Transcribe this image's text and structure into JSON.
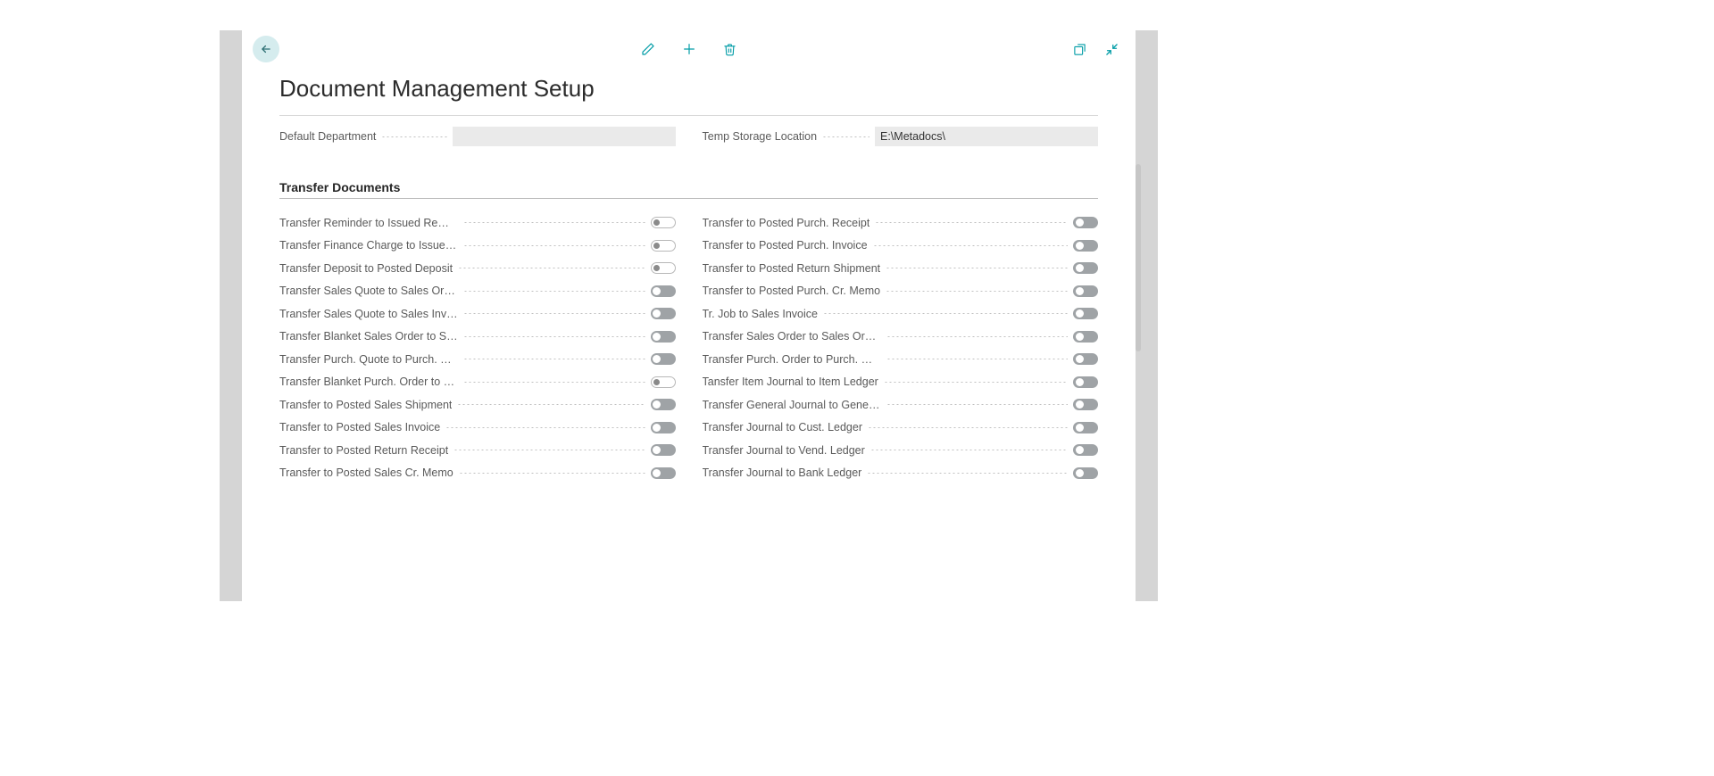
{
  "colors": {
    "accent": "#009ca6",
    "back_bg": "#d5ecee",
    "toggle_on_bg": "#9fa3a6"
  },
  "page": {
    "title": "Document Management Setup"
  },
  "header_fields": {
    "default_department": {
      "label": "Default Department",
      "value": ""
    },
    "temp_storage_location": {
      "label": "Temp Storage Location",
      "value": "E:\\Metadocs\\"
    }
  },
  "section": {
    "title": "Transfer Documents"
  },
  "toggles_left": [
    {
      "label": "Transfer Reminder to Issued Reminder",
      "on": false
    },
    {
      "label": "Transfer Finance Charge to Issued Fin...",
      "on": false
    },
    {
      "label": "Transfer Deposit to Posted Deposit",
      "on": false
    },
    {
      "label": "Transfer Sales Quote to Sales Order",
      "on": true
    },
    {
      "label": "Transfer Sales Quote to Sales Invoice",
      "on": true
    },
    {
      "label": "Transfer Blanket Sales Order to Sales ...",
      "on": true
    },
    {
      "label": "Transfer Purch. Quote to Purch. Order",
      "on": true
    },
    {
      "label": "Transfer Blanket Purch. Order to Purch...",
      "on": false
    },
    {
      "label": "Transfer to Posted Sales Shipment",
      "on": true
    },
    {
      "label": "Transfer to Posted Sales Invoice",
      "on": true
    },
    {
      "label": "Transfer to Posted Return Receipt",
      "on": true
    },
    {
      "label": "Transfer to Posted Sales Cr. Memo",
      "on": true
    }
  ],
  "toggles_right": [
    {
      "label": "Transfer to Posted Purch. Receipt",
      "on": true
    },
    {
      "label": "Transfer to Posted Purch. Invoice",
      "on": true
    },
    {
      "label": "Transfer to Posted Return Shipment",
      "on": true
    },
    {
      "label": "Transfer to Posted Purch. Cr. Memo",
      "on": true
    },
    {
      "label": "Tr. Job to Sales Invoice",
      "on": true
    },
    {
      "label": "Transfer Sales Order to Sales Order Ar...",
      "on": true
    },
    {
      "label": "Transfer Purch. Order to Purch. Order ...",
      "on": true
    },
    {
      "label": "Tansfer Item Journal to Item Ledger",
      "on": true
    },
    {
      "label": "Transfer General Journal to General Le...",
      "on": true
    },
    {
      "label": "Transfer Journal to Cust. Ledger",
      "on": true
    },
    {
      "label": "Transfer Journal to Vend. Ledger",
      "on": true
    },
    {
      "label": "Transfer Journal to Bank Ledger",
      "on": true
    }
  ],
  "icons": {
    "back": "arrow-left-icon",
    "edit": "pencil-icon",
    "new": "plus-icon",
    "delete": "trash-icon",
    "popout": "popout-icon",
    "collapse": "collapse-icon"
  }
}
